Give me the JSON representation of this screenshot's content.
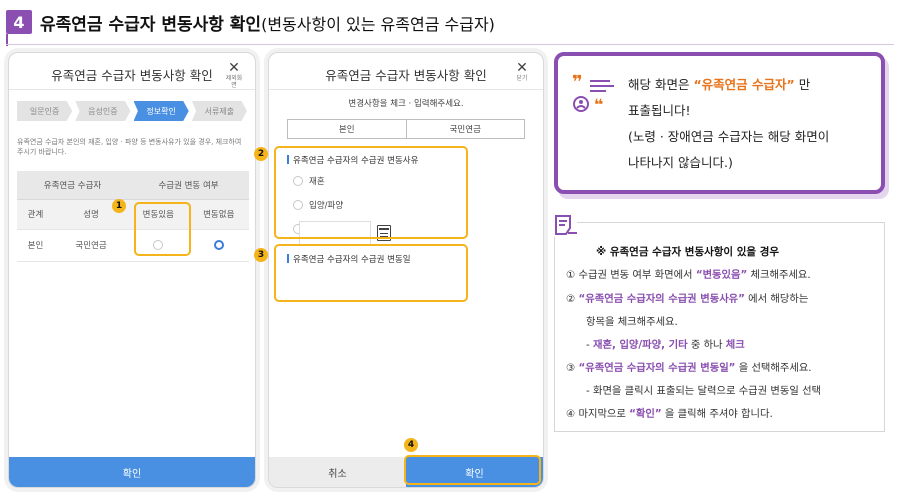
{
  "header": {
    "step_number": "4",
    "title": "유족연금 수급자 변동사항 확인",
    "subtitle": "(변동사항이 있는 유족연금 수급자)"
  },
  "screen_a": {
    "title": "유족연금 수급자 변동사항 확인",
    "close_icon": "close-icon",
    "close_label": "제외화면",
    "steps": [
      "일문인증",
      "음성인증",
      "정보확인",
      "서류제출"
    ],
    "active_step": 2,
    "notice": "유족연금 수급자 본인의 재혼, 입양 · 파양 등 변동사유가 있을 경우, 체크하여 주시기 바랍니다.",
    "table": {
      "group_headers": [
        "유족연금 수급자",
        "수급권 변동 여부"
      ],
      "sub_headers": [
        "관계",
        "성명",
        "변동있음",
        "변동없음"
      ],
      "rows": [
        {
          "relation": "본인",
          "name": "국민연금",
          "changed": false,
          "unchanged": true
        }
      ]
    },
    "confirm_label": "확인",
    "marker": "1"
  },
  "screen_b": {
    "title": "유족연금 수급자 변동사항 확인",
    "close_label": "닫기",
    "prompt": "변경사항을 체크 · 입력해주세요.",
    "tabs": [
      "본인",
      "국민연금"
    ],
    "reason_title": "유족연금 수급자의 수급권 변동사유",
    "reason_options": [
      "재혼",
      "입양/파양",
      "기타"
    ],
    "date_title": "유족연금 수급자의 수급권 변동일",
    "date_value": "",
    "calendar_icon": "calendar-icon",
    "cancel_label": "취소",
    "confirm_label": "확인",
    "markers": [
      "2",
      "3",
      "4"
    ]
  },
  "callout": {
    "icon": "comment-quote-icon",
    "line1_pre": "해당 화면은 ",
    "line1_highlight": "“유족연금 수급자”",
    "line1_post": " 만",
    "line2": "표출됩니다!",
    "line3": "(노령 · 장애연금 수급자는 해당 화면이",
    "line4": "나타나지 않습니다.)"
  },
  "guide": {
    "icon": "document-edit-icon",
    "title": "※ 유족연금 수급자 변동사항이 있을 경우",
    "l1_pre": "① 수급권 변동 여부 화면에서 ",
    "l1_hl": "“변동있음”",
    "l1_post": " 체크해주세요.",
    "l2_pre": "② ",
    "l2_hl": "“유족연금 수급자의 수급권 변동사유”",
    "l2_post": " 에서 해당하는",
    "l3": "항목을 체크해주세요.",
    "l4_pre": "- ",
    "l4_hl1": "재혼, 입양/파양, 기타",
    "l4_mid": " 중 하나 ",
    "l4_hl2": "체크",
    "l5_pre": "③ ",
    "l5_hl": "“유족연금 수급자의 수급권 변동일”",
    "l5_post": " 을 선택해주세요.",
    "l6": "- 화면을 클릭시 표출되는 달력으로 수급권 변동일 선택",
    "l7_pre": "④ 마지막으로 ",
    "l7_hl": "“확인”",
    "l7_post": " 을 클릭해 주셔야 합니다."
  },
  "colors": {
    "accent_purple": "#8a4fb0",
    "marker_yellow": "#f4b41a",
    "button_blue": "#4a90e2",
    "highlight_orange": "#e8731a"
  }
}
